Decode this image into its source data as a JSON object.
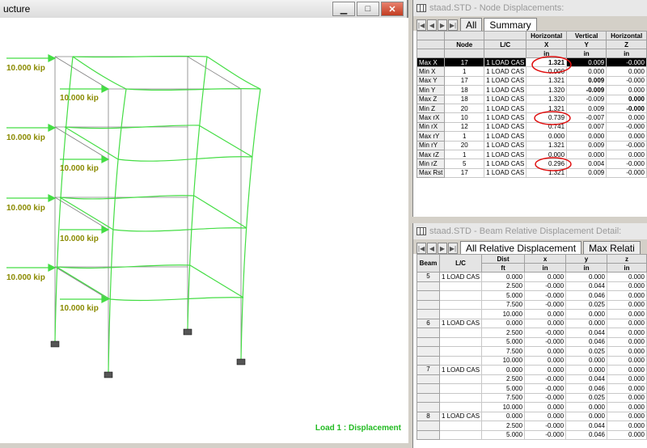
{
  "structure": {
    "title": "ucture",
    "caption": "Load 1 : Displacement",
    "load_label": "10.000 kip"
  },
  "node_panel": {
    "title": "staad.STD - Node Displacements:",
    "tabs": [
      "All",
      "Summary"
    ],
    "headers1": [
      "",
      "",
      "",
      "Horizontal",
      "Vertical",
      "Horizontal"
    ],
    "headers2": [
      "",
      "Node",
      "L/C",
      "X",
      "Y",
      "Z"
    ],
    "headers3": [
      "",
      "",
      "",
      "in",
      "in",
      "in"
    ],
    "rows": [
      [
        "Max X",
        "17",
        "1 LOAD CAS",
        "1.321",
        "0.009",
        "-0.000"
      ],
      [
        "Min X",
        "1",
        "1 LOAD CAS",
        "0.000",
        "0.000",
        "0.000"
      ],
      [
        "Max Y",
        "17",
        "1 LOAD CAS",
        "1.321",
        "0.009",
        "-0.000"
      ],
      [
        "Min Y",
        "18",
        "1 LOAD CAS",
        "1.320",
        "-0.009",
        "0.000"
      ],
      [
        "Max Z",
        "18",
        "1 LOAD CAS",
        "1.320",
        "-0.009",
        "0.000"
      ],
      [
        "Min Z",
        "20",
        "1 LOAD CAS",
        "1.321",
        "0.009",
        "-0.000"
      ],
      [
        "Max rX",
        "10",
        "1 LOAD CAS",
        "0.739",
        "-0.007",
        "0.000"
      ],
      [
        "Min rX",
        "12",
        "1 LOAD CAS",
        "0.741",
        "0.007",
        "-0.000"
      ],
      [
        "Max rY",
        "1",
        "1 LOAD CAS",
        "0.000",
        "0.000",
        "0.000"
      ],
      [
        "Min rY",
        "20",
        "1 LOAD CAS",
        "1.321",
        "0.009",
        "-0.000"
      ],
      [
        "Max rZ",
        "1",
        "1 LOAD CAS",
        "0.000",
        "0.000",
        "0.000"
      ],
      [
        "Min rZ",
        "5",
        "1 LOAD CAS",
        "0.296",
        "0.004",
        "-0.000"
      ],
      [
        "Max Rst",
        "17",
        "1 LOAD CAS",
        "1.321",
        "0.009",
        "-0.000"
      ]
    ]
  },
  "beam_panel": {
    "title": "staad.STD - Beam Relative Displacement Detail:",
    "tabs": [
      "All Relative Displacement",
      "Max Relati"
    ],
    "headers1": [
      "Beam",
      "L/C",
      "Dist",
      "x",
      "y",
      "z"
    ],
    "headers2": [
      "",
      "",
      "ft",
      "in",
      "in",
      "in"
    ],
    "groups": [
      {
        "beam": "5",
        "lc": "1 LOAD CAS",
        "rows": [
          [
            "0.000",
            "0.000",
            "0.000",
            "0.000"
          ],
          [
            "2.500",
            "-0.000",
            "0.044",
            "0.000"
          ],
          [
            "5.000",
            "-0.000",
            "0.046",
            "0.000"
          ],
          [
            "7.500",
            "-0.000",
            "0.025",
            "0.000"
          ],
          [
            "10.000",
            "0.000",
            "0.000",
            "0.000"
          ]
        ]
      },
      {
        "beam": "6",
        "lc": "1 LOAD CAS",
        "rows": [
          [
            "0.000",
            "0.000",
            "0.000",
            "0.000"
          ],
          [
            "2.500",
            "-0.000",
            "0.044",
            "0.000"
          ],
          [
            "5.000",
            "-0.000",
            "0.046",
            "0.000"
          ],
          [
            "7.500",
            "0.000",
            "0.025",
            "0.000"
          ],
          [
            "10.000",
            "0.000",
            "0.000",
            "0.000"
          ]
        ]
      },
      {
        "beam": "7",
        "lc": "1 LOAD CAS",
        "rows": [
          [
            "0.000",
            "0.000",
            "0.000",
            "0.000"
          ],
          [
            "2.500",
            "-0.000",
            "0.044",
            "0.000"
          ],
          [
            "5.000",
            "-0.000",
            "0.046",
            "0.000"
          ],
          [
            "7.500",
            "-0.000",
            "0.025",
            "0.000"
          ],
          [
            "10.000",
            "0.000",
            "0.000",
            "0.000"
          ]
        ]
      },
      {
        "beam": "8",
        "lc": "1 LOAD CAS",
        "rows": [
          [
            "0.000",
            "0.000",
            "0.000",
            "0.000"
          ],
          [
            "2.500",
            "-0.000",
            "0.044",
            "0.000"
          ],
          [
            "5.000",
            "-0.000",
            "0.046",
            "0.000"
          ]
        ]
      }
    ]
  },
  "colors": {
    "frame": "#44dd44",
    "load_text": "#8a8a00",
    "caption": "#22bb22"
  }
}
